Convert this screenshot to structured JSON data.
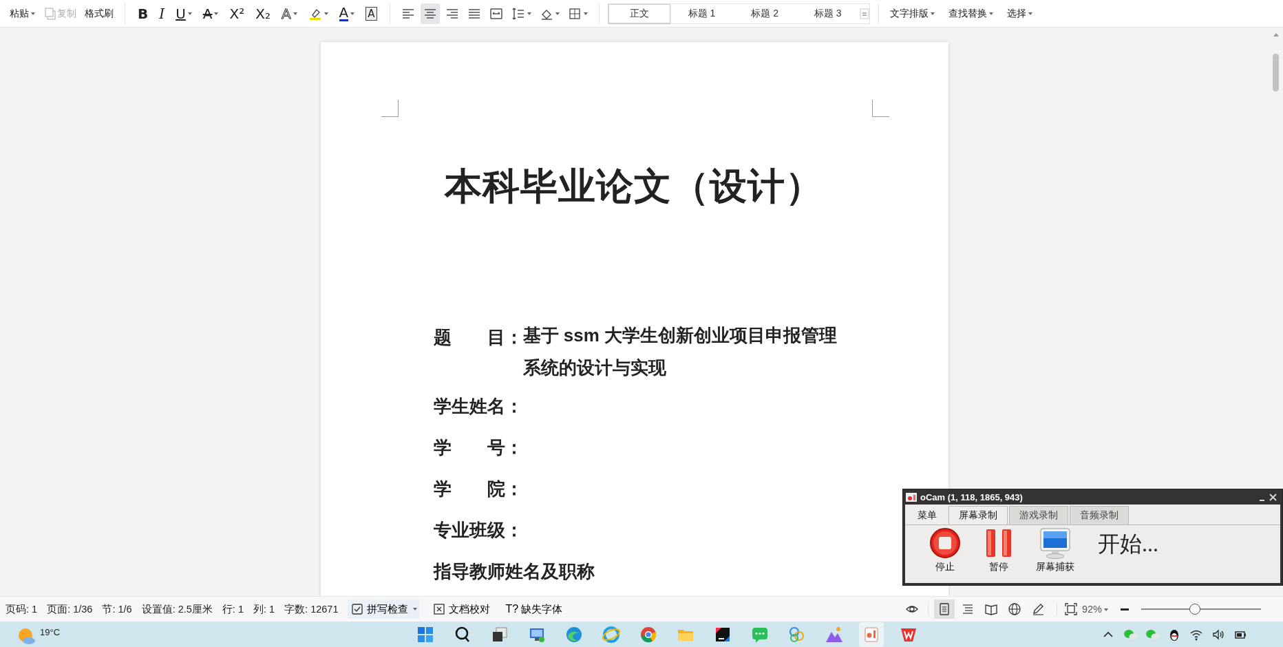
{
  "toolbar": {
    "clipboard": [
      {
        "label": "粘贴",
        "kind": "dropdown",
        "disabled": false
      },
      {
        "label": "复制",
        "kind": "copy",
        "disabled": true
      },
      {
        "label": "格式刷",
        "kind": "plain",
        "disabled": false
      }
    ],
    "font_buttons": [
      {
        "kind": "text",
        "glyph": "B",
        "dropdown": false
      },
      {
        "kind": "text",
        "glyph": "I",
        "dropdown": false
      },
      {
        "kind": "text",
        "glyph": "U",
        "dropdown": true
      },
      {
        "kind": "text",
        "glyph": "A",
        "dropdown": true
      },
      {
        "kind": "text",
        "glyph": "X²",
        "dropdown": false
      },
      {
        "kind": "text",
        "glyph": "X₂",
        "dropdown": false
      },
      {
        "kind": "text",
        "glyph": "A",
        "dropdown": true
      },
      {
        "kind": "highlighter",
        "dropdown": true
      },
      {
        "kind": "text",
        "glyph": "A",
        "dropdown": true
      },
      {
        "kind": "text",
        "glyph": "A",
        "dropdown": false
      }
    ],
    "paragraph_buttons": [
      {
        "kind": "align-left",
        "selected": false,
        "dropdown": false
      },
      {
        "kind": "align-center",
        "selected": true,
        "dropdown": false
      },
      {
        "kind": "align-right",
        "selected": false,
        "dropdown": false
      },
      {
        "kind": "justify",
        "selected": false,
        "dropdown": false
      },
      {
        "kind": "distribute",
        "selected": false,
        "dropdown": false
      },
      {
        "kind": "line-spacing",
        "selected": false,
        "dropdown": true
      },
      {
        "kind": "shading",
        "selected": false,
        "dropdown": true
      },
      {
        "kind": "borders",
        "selected": false,
        "dropdown": true
      }
    ],
    "styles": [
      {
        "label": "正文",
        "selected": true
      },
      {
        "label": "标题 1",
        "selected": false
      },
      {
        "label": "标题 2",
        "selected": false
      },
      {
        "label": "标题 3",
        "selected": false
      }
    ],
    "tools": [
      {
        "label": "文字排版"
      },
      {
        "label": "查找替换"
      },
      {
        "label": "选择"
      }
    ]
  },
  "document": {
    "title": "本科毕业论文（设计）",
    "fields": [
      {
        "label": "题　　目：",
        "lines": [
          "基于 ssm 大学生创新创业项目申报管理",
          "系统的设计与实现"
        ]
      },
      {
        "label": "学生姓名："
      },
      {
        "label": "学　　号："
      },
      {
        "label": "学　　院："
      },
      {
        "label": "专业班级："
      },
      {
        "label": "指导教师姓名及职称"
      }
    ]
  },
  "status_bar": {
    "items": [
      "页码: 1",
      "页面: 1/36",
      "节: 1/6",
      "设置值: 2.5厘米",
      "行: 1",
      "列: 1",
      "字数: 12671"
    ],
    "tools": [
      {
        "kind": "spell",
        "label": "拼写检查"
      },
      {
        "kind": "proof",
        "label": "文档校对"
      },
      {
        "kind": "font",
        "label": "缺失字体",
        "glyph": "T?"
      }
    ],
    "views": [
      {
        "kind": "eye",
        "selected": false
      },
      {
        "kind": "page",
        "selected": true
      },
      {
        "kind": "outline",
        "selected": false
      },
      {
        "kind": "reading",
        "selected": false
      },
      {
        "kind": "web",
        "selected": false
      },
      {
        "kind": "pen",
        "selected": false
      }
    ],
    "zoom": {
      "value": "92%",
      "level": 0.44
    }
  },
  "ocam": {
    "title": "oCam (1, 118, 1865, 943)",
    "tabs": [
      {
        "label": "菜单",
        "selected": false
      },
      {
        "label": "屏幕录制",
        "selected": true
      },
      {
        "label": "游戏录制",
        "selected": false
      },
      {
        "label": "音频录制",
        "selected": false
      }
    ],
    "buttons": [
      {
        "kind": "stop",
        "label": "停止"
      },
      {
        "kind": "pause",
        "label": "暂停"
      },
      {
        "kind": "capture",
        "label": "屏幕捕获"
      }
    ],
    "status": "开始..."
  },
  "taskbar": {
    "weather": "19°C",
    "apps": [
      {
        "kind": "start",
        "selected": false
      },
      {
        "kind": "search",
        "selected": false
      },
      {
        "kind": "taskview",
        "selected": false
      },
      {
        "kind": "remote",
        "selected": false
      },
      {
        "kind": "edge",
        "selected": false
      },
      {
        "kind": "ie",
        "selected": false
      },
      {
        "kind": "chrome",
        "selected": false
      },
      {
        "kind": "folder",
        "selected": false
      },
      {
        "kind": "ide",
        "selected": false
      },
      {
        "kind": "chat",
        "selected": false
      },
      {
        "kind": "petals",
        "selected": false
      },
      {
        "kind": "mountain",
        "selected": false
      },
      {
        "kind": "presenter",
        "selected": true
      },
      {
        "kind": "office",
        "selected": false
      }
    ],
    "tray": [
      {
        "kind": "chevron"
      },
      {
        "kind": "wechat"
      },
      {
        "kind": "wechat"
      },
      {
        "kind": "penguin"
      },
      {
        "kind": "wifi"
      },
      {
        "kind": "volume"
      },
      {
        "kind": "battery"
      }
    ]
  }
}
